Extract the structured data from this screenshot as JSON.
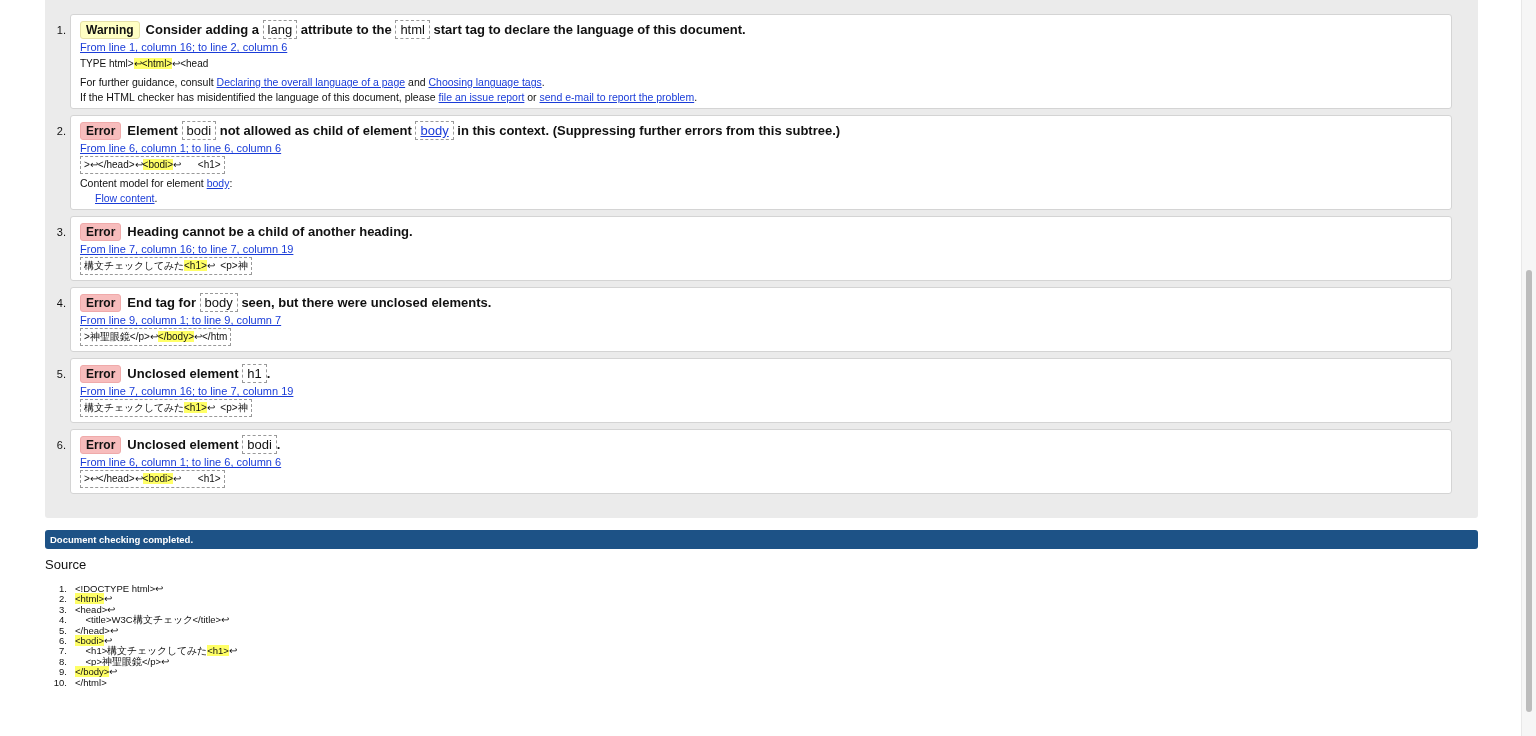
{
  "messages": [
    {
      "number": "1.",
      "kind": "warning",
      "type": "Warning",
      "message": [
        {
          "kind": "text",
          "text": "Consider adding a "
        },
        {
          "kind": "code",
          "text": "lang"
        },
        {
          "kind": "text",
          "text": " attribute to the "
        },
        {
          "kind": "code",
          "text": "html"
        },
        {
          "kind": "text",
          "text": " start tag to declare the language of this document."
        }
      ],
      "location": "From line 1, column 16; to line 2, column 6",
      "extract": {
        "boxed": false,
        "parts": [
          {
            "text": "TYPE html>",
            "highlighted": false
          },
          {
            "text": "↩<html>",
            "highlighted": true
          },
          {
            "text": "↩<head",
            "highlighted": false
          }
        ]
      },
      "notes": [
        {
          "indented": false,
          "parts": [
            {
              "kind": "text",
              "text": "For further guidance, consult "
            },
            {
              "kind": "link",
              "text": "Declaring the overall language of a page"
            },
            {
              "kind": "text",
              "text": " and "
            },
            {
              "kind": "link",
              "text": "Choosing language tags"
            },
            {
              "kind": "text",
              "text": "."
            }
          ]
        },
        {
          "indented": false,
          "parts": [
            {
              "kind": "text",
              "text": "If the HTML checker has misidentified the language of this document, please "
            },
            {
              "kind": "link",
              "text": "file an issue report"
            },
            {
              "kind": "text",
              "text": " or "
            },
            {
              "kind": "link",
              "text": "send e-mail to report the problem"
            },
            {
              "kind": "text",
              "text": "."
            }
          ]
        }
      ]
    },
    {
      "number": "2.",
      "kind": "error",
      "type": "Error",
      "message": [
        {
          "kind": "text",
          "text": "Element "
        },
        {
          "kind": "code",
          "text": "bodi"
        },
        {
          "kind": "text",
          "text": " not allowed as child of element "
        },
        {
          "kind": "code-link",
          "text": "body"
        },
        {
          "kind": "text",
          "text": " in this context. (Suppressing further errors from this subtree.)"
        }
      ],
      "location": "From line 6, column 1; to line 6, column 6",
      "extract": {
        "boxed": true,
        "parts": [
          {
            "text": ">↩</head>↩",
            "highlighted": false
          },
          {
            "text": "<bodi>",
            "highlighted": true
          },
          {
            "text": "↩      <h1>",
            "highlighted": false
          }
        ]
      },
      "notes": [
        {
          "indented": false,
          "parts": [
            {
              "kind": "text",
              "text": "Content model for element "
            },
            {
              "kind": "link",
              "text": "body"
            },
            {
              "kind": "text",
              "text": ":"
            }
          ]
        },
        {
          "indented": true,
          "parts": [
            {
              "kind": "link",
              "text": "Flow content"
            },
            {
              "kind": "text",
              "text": "."
            }
          ]
        }
      ]
    },
    {
      "number": "3.",
      "kind": "error",
      "type": "Error",
      "message": [
        {
          "kind": "text",
          "text": "Heading cannot be a child of another heading."
        }
      ],
      "location": "From line 7, column 16; to line 7, column 19",
      "extract": {
        "boxed": true,
        "parts": [
          {
            "text": "構文チェックしてみた",
            "highlighted": false
          },
          {
            "text": "<h1>",
            "highlighted": true
          },
          {
            "text": "↩  <p>神",
            "highlighted": false
          }
        ]
      }
    },
    {
      "number": "4.",
      "kind": "error",
      "type": "Error",
      "message": [
        {
          "kind": "text",
          "text": "End tag for "
        },
        {
          "kind": "code",
          "text": "body"
        },
        {
          "kind": "text",
          "text": " seen, but there were unclosed elements."
        }
      ],
      "location": "From line 9, column 1; to line 9, column 7",
      "extract": {
        "boxed": true,
        "parts": [
          {
            "text": ">神聖眼鏡</p>↩",
            "highlighted": false
          },
          {
            "text": "</body>",
            "highlighted": true
          },
          {
            "text": "↩</htm",
            "highlighted": false
          }
        ]
      }
    },
    {
      "number": "5.",
      "kind": "error",
      "type": "Error",
      "message": [
        {
          "kind": "text",
          "text": "Unclosed element "
        },
        {
          "kind": "code",
          "text": "h1"
        },
        {
          "kind": "text",
          "text": "."
        }
      ],
      "location": "From line 7, column 16; to line 7, column 19",
      "extract": {
        "boxed": true,
        "parts": [
          {
            "text": "構文チェックしてみた",
            "highlighted": false
          },
          {
            "text": "<h1>",
            "highlighted": true
          },
          {
            "text": "↩  <p>神",
            "highlighted": false
          }
        ]
      }
    },
    {
      "number": "6.",
      "kind": "error",
      "type": "Error",
      "message": [
        {
          "kind": "text",
          "text": "Unclosed element "
        },
        {
          "kind": "code",
          "text": "bodi"
        },
        {
          "kind": "text",
          "text": "."
        }
      ],
      "location": "From line 6, column 1; to line 6, column 6",
      "extract": {
        "boxed": true,
        "parts": [
          {
            "text": ">↩</head>↩",
            "highlighted": false
          },
          {
            "text": "<bodi>",
            "highlighted": true
          },
          {
            "text": "↩      <h1>",
            "highlighted": false
          }
        ]
      }
    }
  ],
  "status_bar": "Document checking completed.",
  "source": {
    "title": "Source",
    "lines": [
      {
        "number": "1.",
        "parts": [
          {
            "text": "<!DOCTYPE html>↩",
            "highlighted": false
          }
        ]
      },
      {
        "number": "2.",
        "parts": [
          {
            "text": "<html>",
            "highlighted": true
          },
          {
            "text": "↩",
            "highlighted": false
          }
        ]
      },
      {
        "number": "3.",
        "parts": [
          {
            "text": "<head>↩",
            "highlighted": false
          }
        ]
      },
      {
        "number": "4.",
        "parts": [
          {
            "text": "\t<title>W3C構文チェック</title>↩",
            "highlighted": false
          }
        ]
      },
      {
        "number": "5.",
        "parts": [
          {
            "text": "</head>↩",
            "highlighted": false
          }
        ]
      },
      {
        "number": "6.",
        "parts": [
          {
            "text": "<bodi>",
            "highlighted": true
          },
          {
            "text": "↩",
            "highlighted": false
          }
        ]
      },
      {
        "number": "7.",
        "parts": [
          {
            "text": "\t<h1>構文チェックしてみた",
            "highlighted": false
          },
          {
            "text": "<h1>",
            "highlighted": true
          },
          {
            "text": "↩",
            "highlighted": false
          }
        ]
      },
      {
        "number": "8.",
        "parts": [
          {
            "text": "\t<p>神聖眼鏡</p>↩",
            "highlighted": false
          }
        ]
      },
      {
        "number": "9.",
        "parts": [
          {
            "text": "</body>",
            "highlighted": true
          },
          {
            "text": "↩",
            "highlighted": false
          }
        ]
      },
      {
        "number": "10.",
        "parts": [
          {
            "text": "</html>",
            "highlighted": false
          }
        ]
      }
    ]
  }
}
